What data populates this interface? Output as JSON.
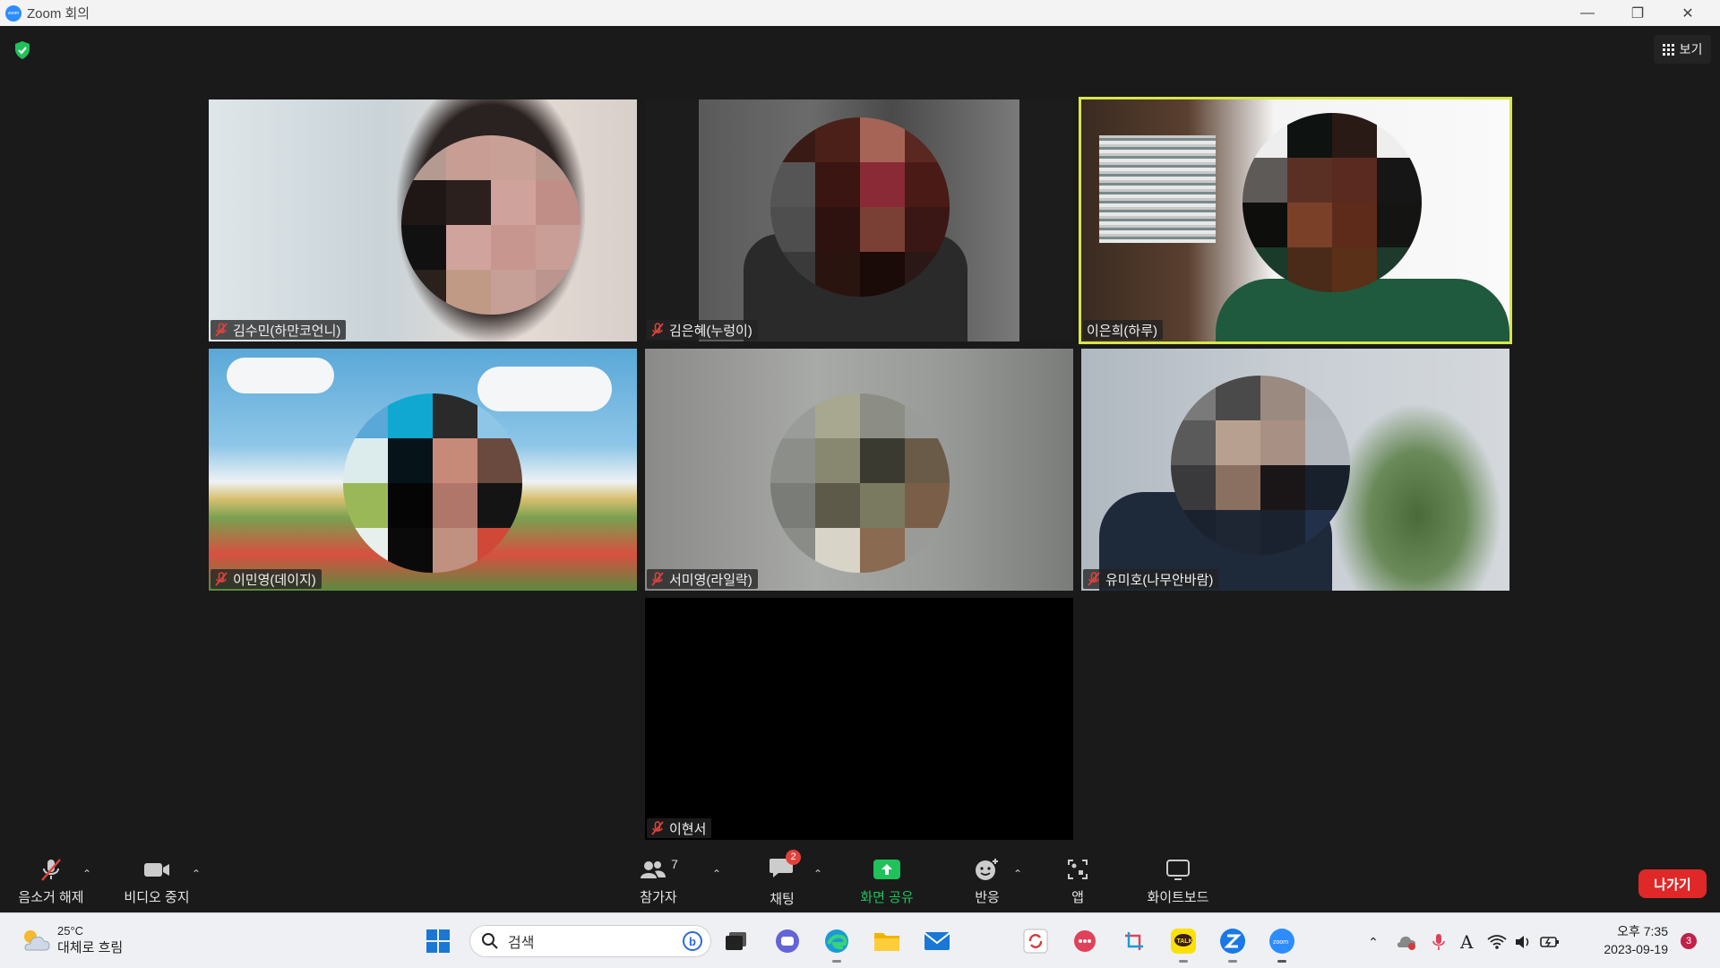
{
  "window": {
    "title": "Zoom 회의",
    "logo_text": "zoom"
  },
  "header": {
    "view_label": "보기"
  },
  "participants": [
    {
      "name": "김수민(하만코언니)",
      "muted": true
    },
    {
      "name": "김은혜(누렁이)",
      "muted": true
    },
    {
      "name": "이은희(하루)",
      "muted": false,
      "active_speaker": true
    },
    {
      "name": "이민영(데이지)",
      "muted": true
    },
    {
      "name": "서미영(라일락)",
      "muted": true
    },
    {
      "name": "유미호(나무안바람)",
      "muted": true
    },
    {
      "name": "이현서",
      "muted": true,
      "video_off": true
    }
  ],
  "toolbar": {
    "unmute_label": "음소거 해제",
    "video_label": "비디오 중지",
    "participants_label": "참가자",
    "participants_count": "7",
    "chat_label": "채팅",
    "chat_badge": "2",
    "share_label": "화면 공유",
    "reactions_label": "반응",
    "apps_label": "앱",
    "whiteboard_label": "화이트보드",
    "leave_label": "나가기"
  },
  "taskbar": {
    "weather_temp": "25°C",
    "weather_desc": "대체로 흐림",
    "search_placeholder": "검색",
    "clock_time": "오후 7:35",
    "clock_date": "2023-09-19",
    "notification_count": "3",
    "kakao_label": "TALK",
    "zoom_label": "zoom"
  },
  "colors": {
    "accent_green": "#20c15a",
    "leave_red": "#e02828",
    "active_speaker": "#d8e64a",
    "mute_red": "#e0413c"
  }
}
